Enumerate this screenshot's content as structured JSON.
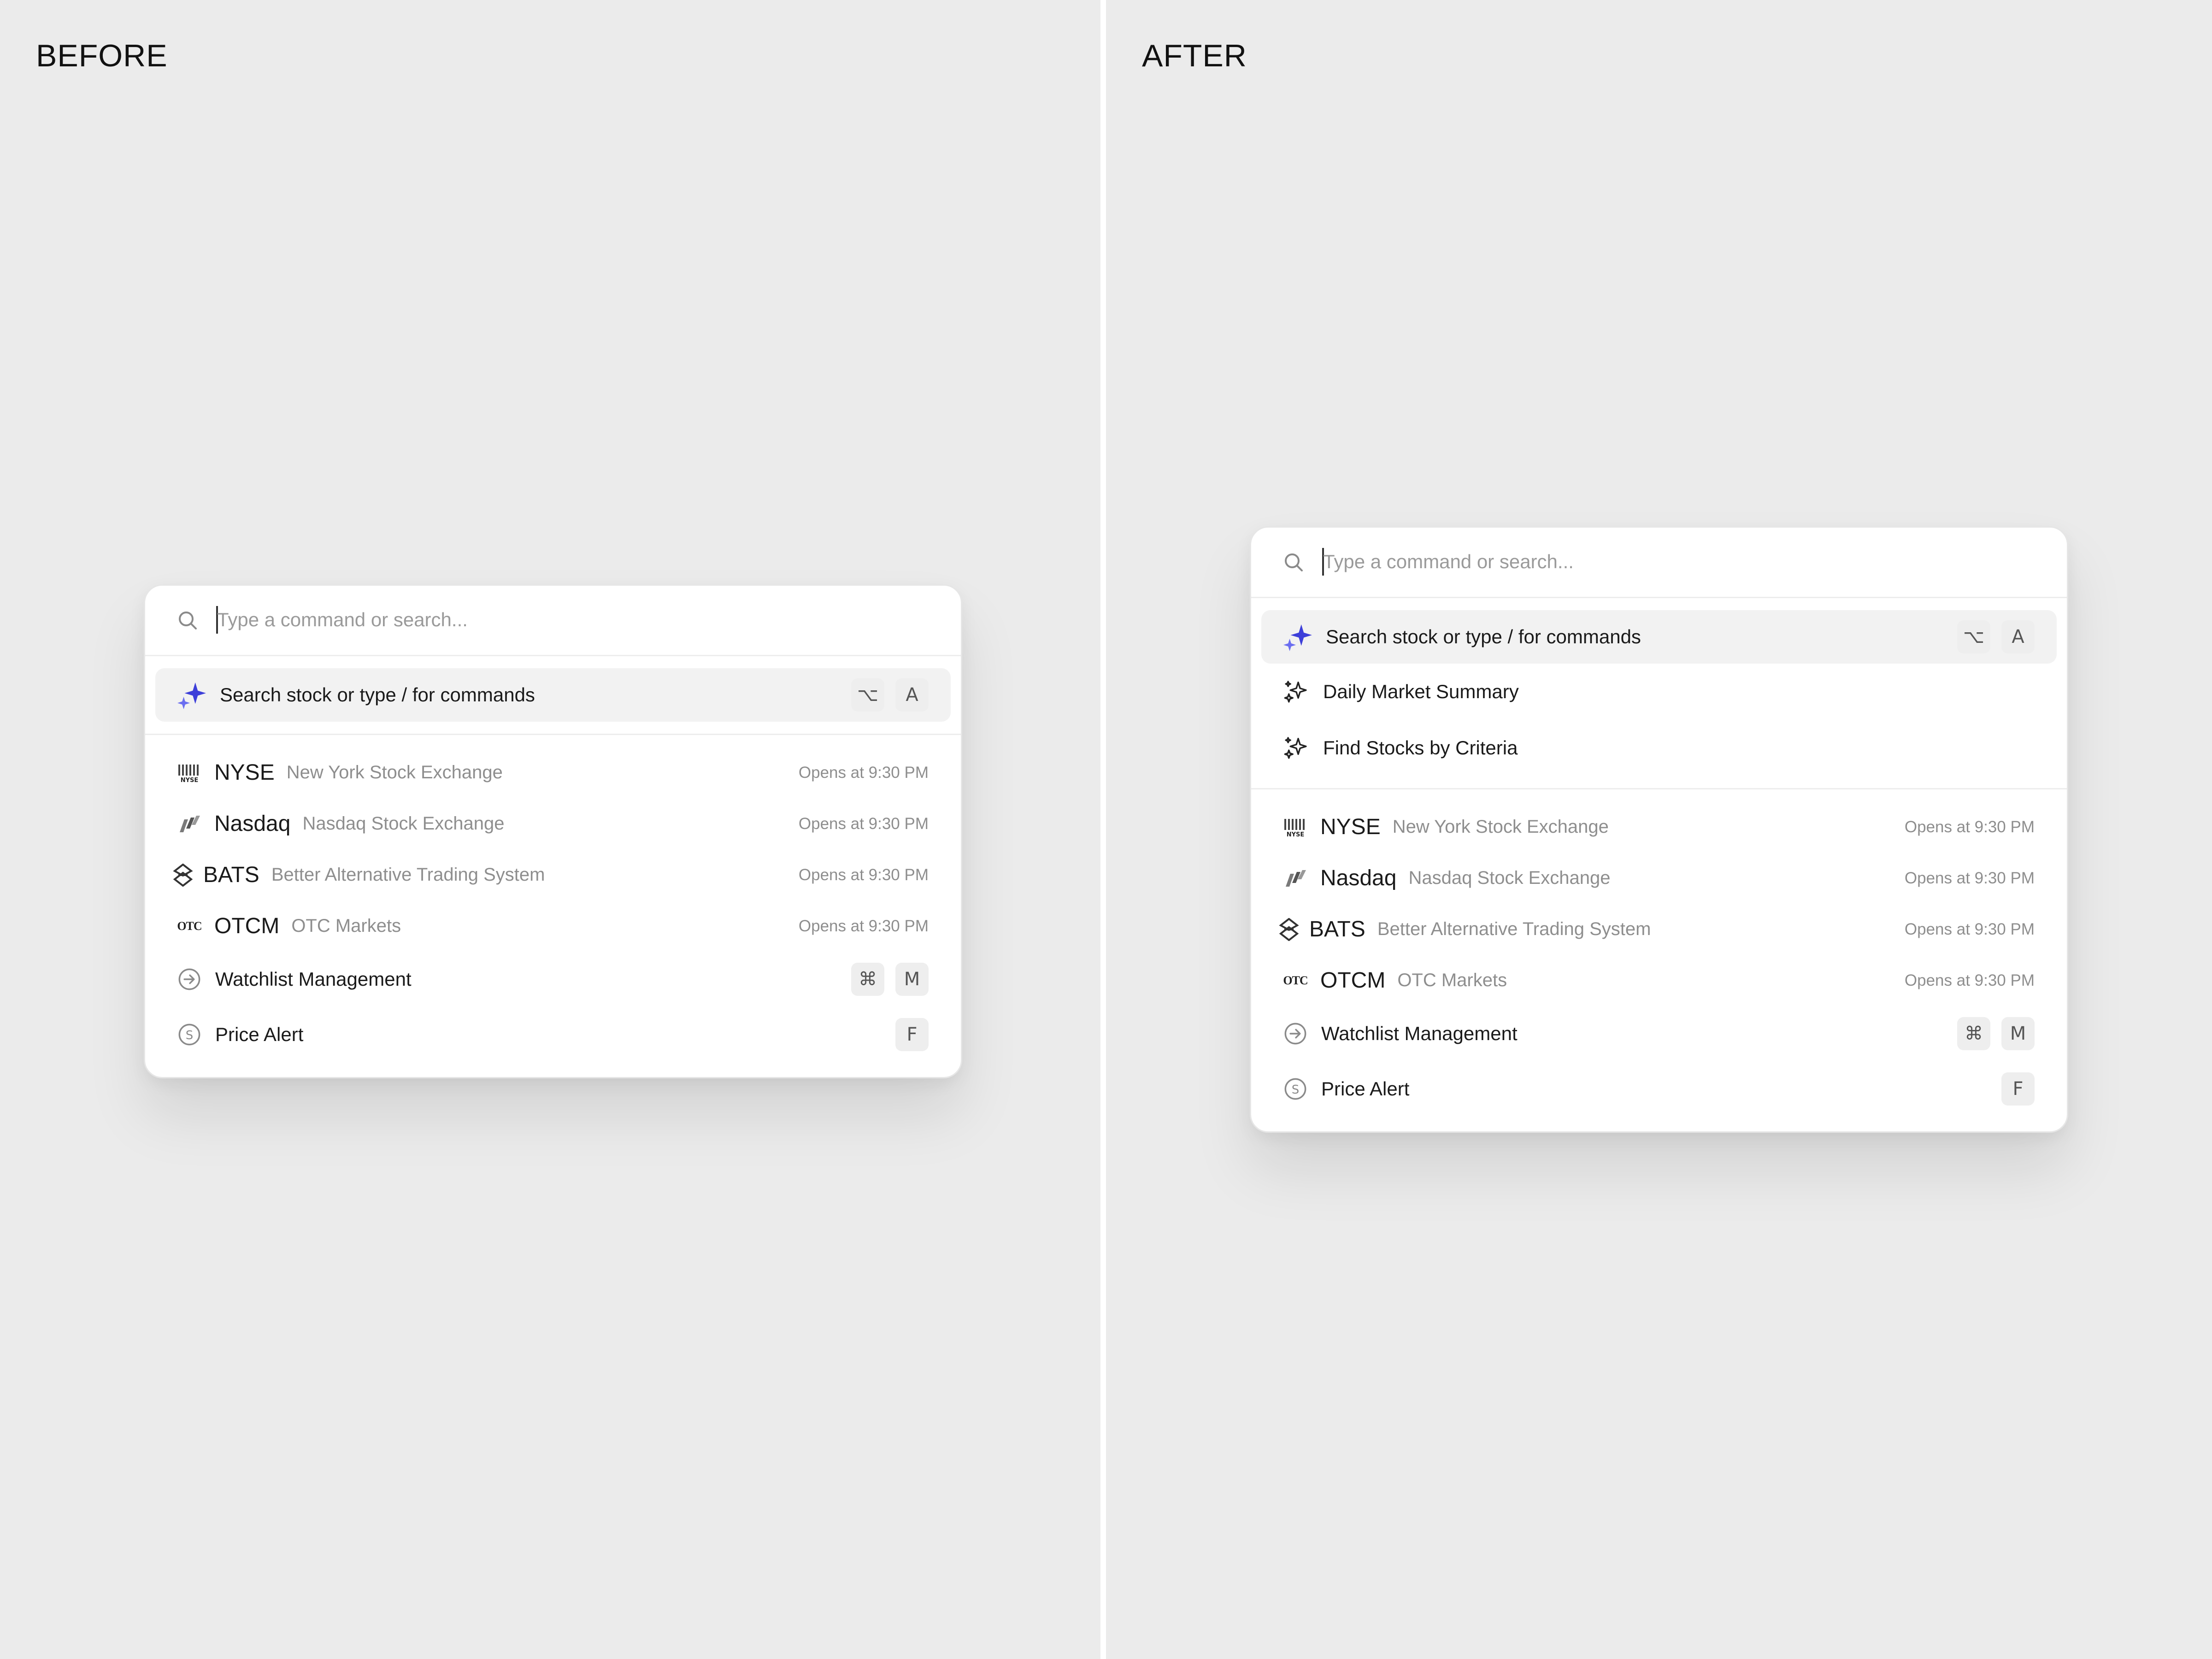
{
  "labels": {
    "before": "BEFORE",
    "after": "AFTER"
  },
  "search": {
    "placeholder": "Type a command or search..."
  },
  "ai": {
    "main_label": "Search stock or type / for commands",
    "main_keys": [
      "⌥",
      "A"
    ],
    "daily_summary": "Daily Market Summary",
    "find_stocks": "Find Stocks by Criteria"
  },
  "exchanges": [
    {
      "icon": "nyse-logo-icon",
      "code": "NYSE",
      "name": "New York Stock Exchange",
      "status": "Opens at 9:30 PM"
    },
    {
      "icon": "nasdaq-logo-icon",
      "code": "Nasdaq",
      "name": "Nasdaq Stock Exchange",
      "status": "Opens at 9:30 PM"
    },
    {
      "icon": "bats-logo-icon",
      "code": "BATS",
      "name": "Better Alternative Trading System",
      "status": "Opens at 9:30 PM"
    },
    {
      "icon": "otc-logo-icon",
      "code": "OTCM",
      "name": "OTC Markets",
      "status": "Opens at 9:30 PM",
      "logo_text": "OTC"
    }
  ],
  "actions": {
    "watchlist": {
      "label": "Watchlist Management",
      "keys": [
        "⌘",
        "M"
      ],
      "icon": "arrow-right-circle-icon"
    },
    "price_alert": {
      "label": "Price Alert",
      "keys": [
        "F"
      ],
      "icon": "dollar-circle-icon"
    }
  },
  "colors": {
    "background": "#ebebeb",
    "accent": "#3d3fd9",
    "accent_light": "#6b6ef0",
    "muted": "#8e8e8e"
  }
}
